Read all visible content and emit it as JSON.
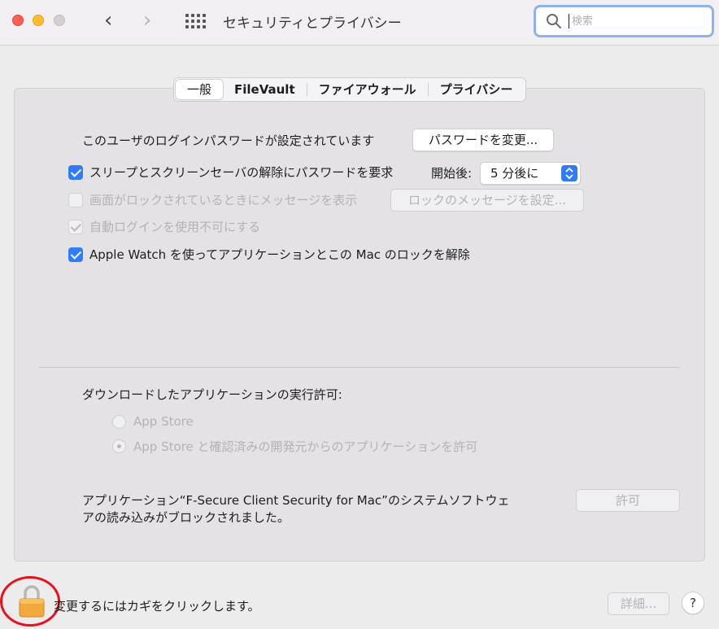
{
  "window": {
    "title": "セキュリティとプライバシー"
  },
  "search": {
    "placeholder": "検索",
    "value": ""
  },
  "tabs": [
    {
      "label": "一般",
      "active": true
    },
    {
      "label": "FileVault",
      "active": false
    },
    {
      "label": "ファイアウォール",
      "active": false
    },
    {
      "label": "プライバシー",
      "active": false
    }
  ],
  "general": {
    "login_password_text": "このユーザのログインパスワードが設定されています",
    "change_password_button": "パスワードを変更...",
    "require_password": {
      "label": "スリープとスクリーンセーバの解除にパスワードを要求",
      "checked": true
    },
    "start_after_label": "開始後:",
    "start_after_value": "5 分後に",
    "show_message": {
      "label": "画面がロックされているときにメッセージを表示",
      "checked": false,
      "disabled": true
    },
    "set_lock_message_button": "ロックのメッセージを設定...",
    "disable_auto_login": {
      "label": "自動ログインを使用不可にする",
      "checked": true,
      "disabled": true
    },
    "apple_watch": {
      "label": "Apple Watch を使ってアプリケーションとこの Mac のロックを解除",
      "checked": true
    }
  },
  "downloads": {
    "heading": "ダウンロードしたアプリケーションの実行許可:",
    "options": [
      {
        "label": "App Store",
        "selected": false
      },
      {
        "label": "App Store と確認済みの開発元からのアプリケーションを許可",
        "selected": true
      }
    ]
  },
  "blocked": {
    "line1": "アプリケーション“F-Secure Client Security for Mac”のシステムソフトウェ",
    "line2": "アの読み込みがブロックされました。",
    "allow_button": "許可"
  },
  "footer": {
    "lock_text": "変更するにはカギをクリックします。",
    "advanced_button": "詳細...",
    "help_label": "?"
  },
  "colors": {
    "accent": "#2f7cf6",
    "highlight_ring": "#e8121c"
  }
}
